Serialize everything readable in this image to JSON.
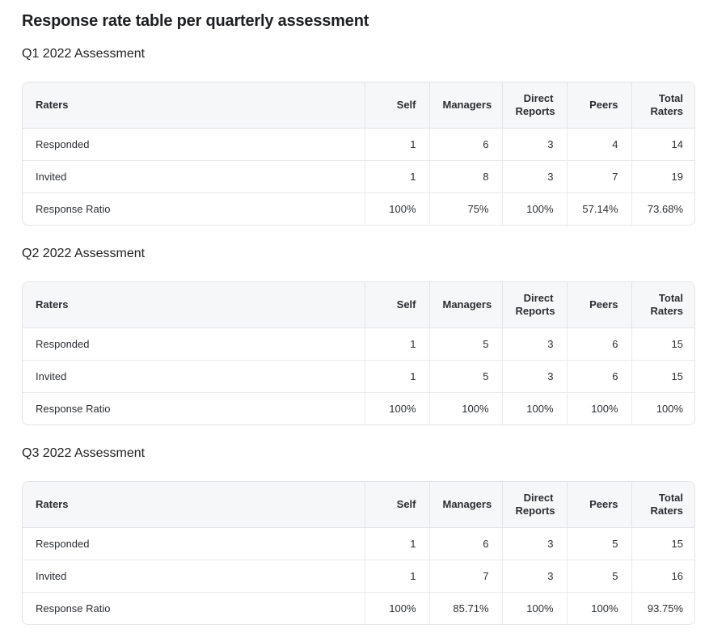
{
  "page_title": "Response rate table per quarterly assessment",
  "columns": {
    "raters": "Raters",
    "self": "Self",
    "managers": "Managers",
    "direct_line1": "Direct",
    "direct_line2": "Reports",
    "peers": "Peers",
    "total_line1": "Total",
    "total_line2": "Raters"
  },
  "sections": [
    {
      "title": "Q1 2022 Assessment",
      "rows": [
        {
          "label": "Responded",
          "self": "1",
          "managers": "6",
          "direct": "3",
          "peers": "4",
          "total": "14"
        },
        {
          "label": "Invited",
          "self": "1",
          "managers": "8",
          "direct": "3",
          "peers": "7",
          "total": "19"
        },
        {
          "label": "Response Ratio",
          "self": "100%",
          "managers": "75%",
          "direct": "100%",
          "peers": "57.14%",
          "total": "73.68%"
        }
      ]
    },
    {
      "title": "Q2 2022 Assessment",
      "rows": [
        {
          "label": "Responded",
          "self": "1",
          "managers": "5",
          "direct": "3",
          "peers": "6",
          "total": "15"
        },
        {
          "label": "Invited",
          "self": "1",
          "managers": "5",
          "direct": "3",
          "peers": "6",
          "total": "15"
        },
        {
          "label": "Response Ratio",
          "self": "100%",
          "managers": "100%",
          "direct": "100%",
          "peers": "100%",
          "total": "100%"
        }
      ]
    },
    {
      "title": "Q3 2022 Assessment",
      "rows": [
        {
          "label": "Responded",
          "self": "1",
          "managers": "6",
          "direct": "3",
          "peers": "5",
          "total": "15"
        },
        {
          "label": "Invited",
          "self": "1",
          "managers": "7",
          "direct": "3",
          "peers": "5",
          "total": "16"
        },
        {
          "label": "Response Ratio",
          "self": "100%",
          "managers": "85.71%",
          "direct": "100%",
          "peers": "100%",
          "total": "93.75%"
        }
      ]
    }
  ]
}
